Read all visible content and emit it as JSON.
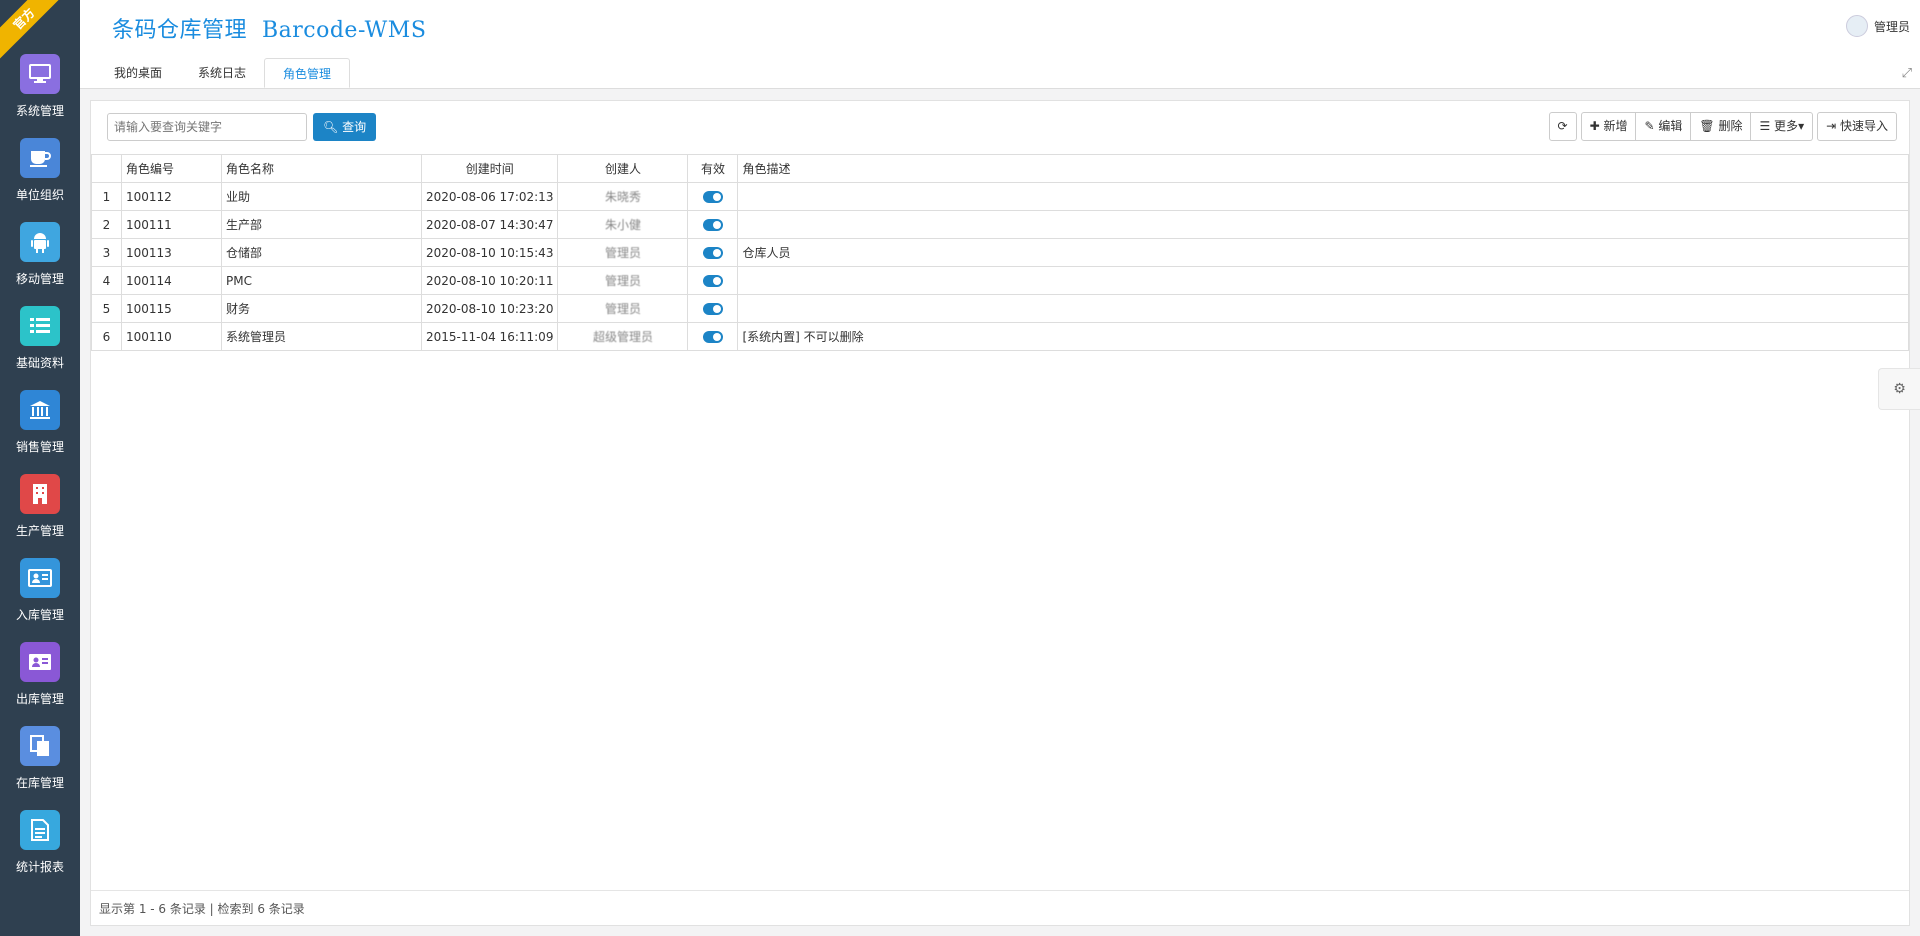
{
  "sidebar": {
    "ribbon": "官方",
    "items": [
      {
        "label": "系统管理",
        "icon": "monitor-icon",
        "color": "#8a6fe0"
      },
      {
        "label": "单位组织",
        "icon": "cup-icon",
        "color": "#4a86d8"
      },
      {
        "label": "移动管理",
        "icon": "android-icon",
        "color": "#3fa6e0"
      },
      {
        "label": "基础资料",
        "icon": "list-icon",
        "color": "#2cc3c9"
      },
      {
        "label": "销售管理",
        "icon": "bank-icon",
        "color": "#2f86d6"
      },
      {
        "label": "生产管理",
        "icon": "building-icon",
        "color": "#e04848"
      },
      {
        "label": "入库管理",
        "icon": "id-card-icon",
        "color": "#3495db"
      },
      {
        "label": "出库管理",
        "icon": "address-card-icon",
        "color": "#8a58d6"
      },
      {
        "label": "在库管理",
        "icon": "files-icon",
        "color": "#5a8ee0"
      },
      {
        "label": "统计报表",
        "icon": "file-text-icon",
        "color": "#37a8de"
      }
    ]
  },
  "header": {
    "title": "条码仓库管理  Barcode-WMS",
    "user": "管理员",
    "tabs": [
      "我的桌面",
      "系统日志",
      "角色管理"
    ],
    "active_tab": 2
  },
  "toolbar": {
    "search_placeholder": "请输入要查询关键字",
    "search_label": "查询",
    "add_label": "新增",
    "edit_label": "编辑",
    "delete_label": "删除",
    "more_label": "更多",
    "import_label": "快速导入"
  },
  "table": {
    "columns": [
      "",
      "角色编号",
      "角色名称",
      "创建时间",
      "创建人",
      "有效",
      "角色描述"
    ],
    "rows": [
      {
        "idx": "1",
        "code": "100112",
        "name": "业助",
        "time": "2020-08-06 17:02:13",
        "creator": "朱晓秀",
        "valid": true,
        "desc": ""
      },
      {
        "idx": "2",
        "code": "100111",
        "name": "生产部",
        "time": "2020-08-07 14:30:47",
        "creator": "朱小健",
        "valid": true,
        "desc": ""
      },
      {
        "idx": "3",
        "code": "100113",
        "name": "仓储部",
        "time": "2020-08-10 10:15:43",
        "creator": "管理员",
        "valid": true,
        "desc": "仓库人员"
      },
      {
        "idx": "4",
        "code": "100114",
        "name": "PMC",
        "time": "2020-08-10 10:20:11",
        "creator": "管理员",
        "valid": true,
        "desc": ""
      },
      {
        "idx": "5",
        "code": "100115",
        "name": "财务",
        "time": "2020-08-10 10:23:20",
        "creator": "管理员",
        "valid": true,
        "desc": ""
      },
      {
        "idx": "6",
        "code": "100110",
        "name": "系统管理员",
        "time": "2015-11-04 16:11:09",
        "creator": "超级管理员",
        "valid": true,
        "desc": "[系统内置] 不可以删除"
      }
    ]
  },
  "pager": {
    "info": "显示第 1 - 6 条记录 | 检索到 6 条记录"
  },
  "colors": {
    "accent": "#1c84c6",
    "sidebar_bg": "#2f4050",
    "title": "#1a8cdf"
  }
}
